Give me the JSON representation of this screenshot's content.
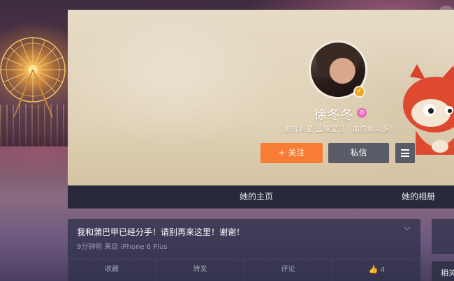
{
  "profile": {
    "name": "徐冬冬",
    "bio": "影视新星 篮球宝贝《如你那么多》"
  },
  "buttons": {
    "follow_label": "+ 关注",
    "message_label": "私信"
  },
  "nav": {
    "home": "她的主页",
    "album": "她的相册"
  },
  "post": {
    "text": "我和蒲巴甲已经分手！请别再来这里！谢谢！",
    "meta": "9分钟前 来自 iPhone 6 Plus",
    "actions": {
      "favorite": "收藏",
      "repost": "转发",
      "comment": "评论",
      "like_count": "4"
    }
  },
  "side": {
    "label": "相关"
  },
  "colors": {
    "follow": "#f77d34",
    "secondary_button": "#595b67",
    "nav_bg": "#282a3c",
    "verified": "#f1a51c"
  }
}
